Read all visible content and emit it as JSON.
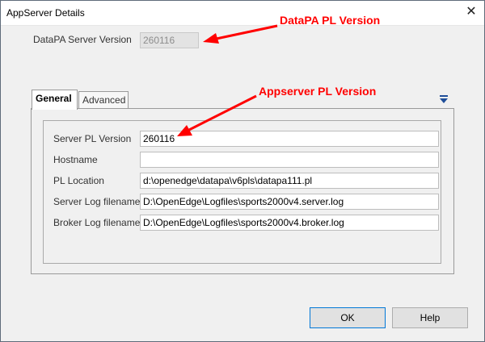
{
  "window": {
    "title": "AppServer Details",
    "close_glyph": "✕"
  },
  "datapa": {
    "label": "DataPA Server Version",
    "value": "260116"
  },
  "tabs": [
    {
      "label": "General",
      "active": true
    },
    {
      "label": "Advanced",
      "active": false
    }
  ],
  "general": {
    "fields": [
      {
        "label": "Server PL Version",
        "value": "260116"
      },
      {
        "label": "Hostname",
        "value": ""
      },
      {
        "label": "PL Location",
        "value": "d:\\openedge\\datapa\\v6pls\\datapa111.pl"
      },
      {
        "label": "Server Log filename",
        "value": "D:\\OpenEdge\\Logfiles\\sports2000v4.server.log"
      },
      {
        "label": "Broker Log filename",
        "value": "D:\\OpenEdge\\Logfiles\\sports2000v4.broker.log"
      }
    ]
  },
  "buttons": {
    "ok": "OK",
    "help": "Help"
  },
  "annotations": {
    "datapa_pl_version": "DataPA PL Version",
    "appserver_pl_version": "Appserver PL Version"
  },
  "colors": {
    "annotation": "#ff0000",
    "tab_menu_icon": "#1f4e99"
  },
  "icons": {
    "close": "close-icon",
    "tab_menu": "chevron-down-icon"
  }
}
